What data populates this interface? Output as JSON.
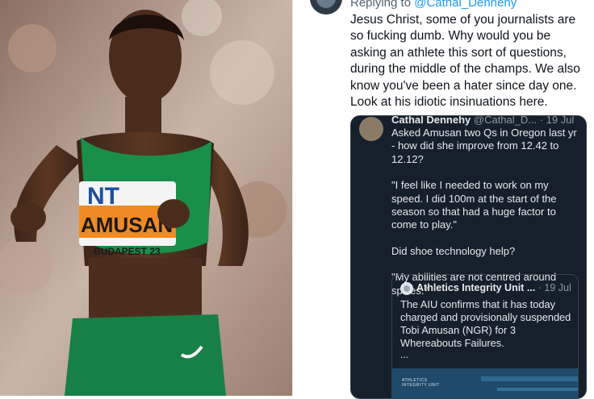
{
  "tweet": {
    "replying_label": "Replying to",
    "replying_handle": "@Cathal_Dennehy",
    "text": "Jesus Christ, some of you journalists are so fucking dumb. Why would you be asking an athlete this sort of questions, during the middle of the champs.  We also know you've been a hater since day one. Look at his idiotic insinuations here."
  },
  "quote": {
    "author_name": "Cathal Dennehy",
    "author_handle": "@Cathal_D...",
    "date": "· 19 Jul",
    "paragraphs": [
      "Asked Amusan two Qs in Oregon last yr - how did she improve from 12.42 to 12.12?",
      "\"I feel like I needed to work on my speed. I did 100m at the start of the season so that had a huge factor to come to play.\"",
      "Did shoe technology help?",
      "\"My abilities are not centred around spikes.\""
    ],
    "nested": {
      "author_name": "Athletics Integrity Unit ...",
      "date": "· 19 Jul",
      "text": "The AIU confirms that it has today charged and provisionally suspended Tobi Amusan (NGR) for 3 Whereabouts Failures.",
      "more": "...",
      "image_logo_text": "ATHLETICS INTEGRITY UNIT"
    }
  },
  "photo": {
    "bib_top": "NT",
    "bib_name": "AMUSAN",
    "bib_city": "BUDAPEST 23"
  },
  "colors": {
    "kit_green": "#1a8f4a",
    "bib_orange": "#f08a24",
    "quote_bg": "#15202b",
    "link_blue": "#1d9bf0"
  }
}
